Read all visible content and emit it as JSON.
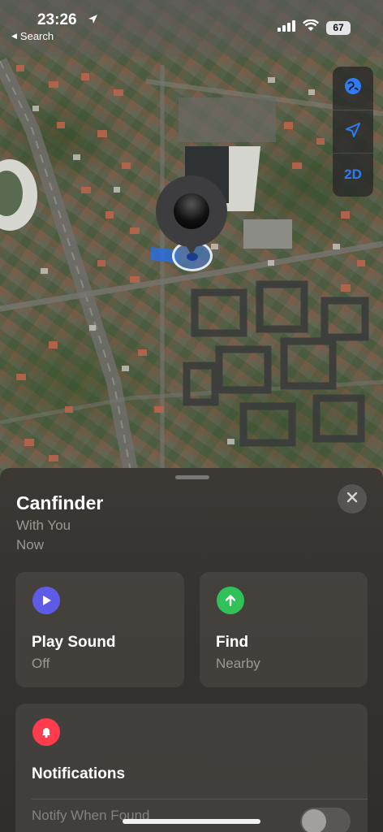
{
  "status_bar": {
    "time": "23:26",
    "back_label": "Search",
    "battery": "67"
  },
  "map": {
    "controls": [
      {
        "name": "globe-icon"
      },
      {
        "name": "location-arrow-icon"
      },
      {
        "label": "2D"
      }
    ],
    "accent_color": "#2d7cf6"
  },
  "device": {
    "name": "Canfinder",
    "status": "With You",
    "time": "Now"
  },
  "actions": {
    "play_sound": {
      "title": "Play Sound",
      "subtitle": "Off",
      "icon": "play-icon",
      "color": "#5e5ce6"
    },
    "find": {
      "title": "Find",
      "subtitle": "Nearby",
      "icon": "arrow-up-icon",
      "color": "#30c158"
    }
  },
  "notifications": {
    "title": "Notifications",
    "icon": "bell-icon",
    "color": "#ff3b4e",
    "notify_when_found": {
      "label": "Notify When Found",
      "enabled": false
    }
  }
}
